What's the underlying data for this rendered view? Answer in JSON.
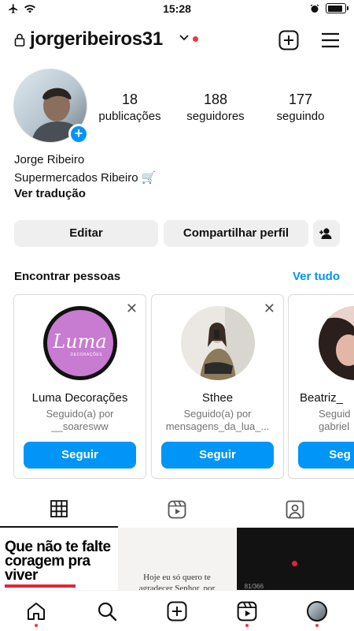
{
  "status_bar": {
    "time": "15:28"
  },
  "header": {
    "username": "jorgeribeiros31"
  },
  "profile": {
    "stats": [
      {
        "number": "18",
        "label": "publicações"
      },
      {
        "number": "188",
        "label": "seguidores"
      },
      {
        "number": "177",
        "label": "seguindo"
      }
    ],
    "full_name": "Jorge Ribeiro",
    "bio": "Supermercados Ribeiro 🛒",
    "translate_link": "Ver tradução"
  },
  "actions": {
    "edit": "Editar",
    "share": "Compartilhar perfil"
  },
  "discover": {
    "title": "Encontrar pessoas",
    "see_all": "Ver tudo",
    "cards": [
      {
        "name": "Luma Decorações",
        "sub1": "Seguido(a) por",
        "sub2": "__soaresww",
        "follow": "Seguir",
        "logo_text": "Luma",
        "logo_sub": "DECORAÇÕES"
      },
      {
        "name": "Sthee",
        "sub1": "Seguido(a) por",
        "sub2": "mensagens_da_lua_...",
        "follow": "Seguir"
      },
      {
        "name": "Beatriz_",
        "sub1": "Seguid",
        "sub2": "gabriel",
        "follow": "Seg"
      }
    ]
  },
  "grid": {
    "tile1_text": "Que não te falte coragem pra viver",
    "tile2_line1": "Hoje eu só quero te",
    "tile2_line2": "agradecer Senhor, por",
    "tile3_count": "81/366"
  },
  "colors": {
    "accent": "#0095f6",
    "notification": "#ff3040"
  },
  "icons": {
    "header": [
      "lock-icon",
      "chevron-down-icon",
      "add-post-icon",
      "menu-icon"
    ],
    "tabs": [
      "grid-icon",
      "reels-icon",
      "tagged-icon"
    ],
    "nav": [
      "home-icon",
      "search-icon",
      "create-icon",
      "reels-icon",
      "profile-avatar"
    ]
  }
}
